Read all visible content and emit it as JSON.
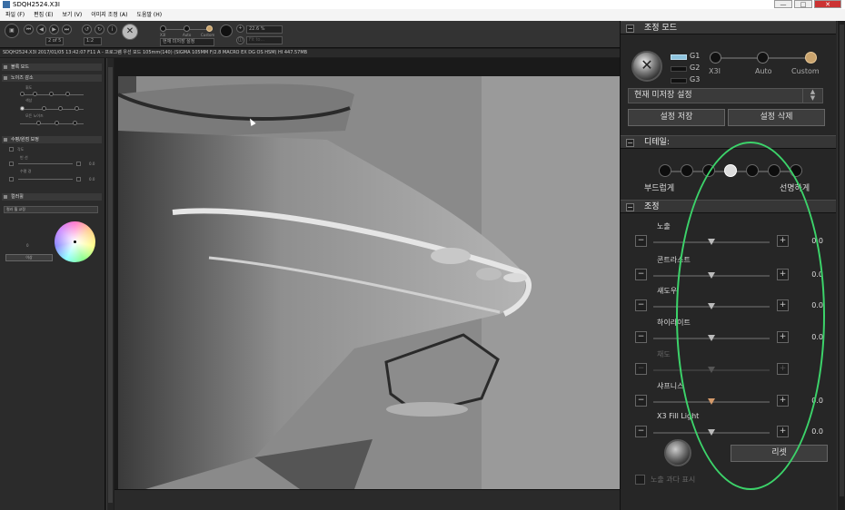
{
  "window": {
    "title": "SDQH2524.X3I",
    "buttons": [
      "—",
      "□",
      "✕"
    ]
  },
  "menu": [
    {
      "label": "파일 (F)"
    },
    {
      "label": "편집 (E)"
    },
    {
      "label": "보기 (V)"
    },
    {
      "label": "이미지 조정 (A)"
    },
    {
      "label": "도움말 (H)"
    }
  ],
  "toolbar": {
    "page": "2 of 5",
    "ratio": "1:2",
    "mode_labels": [
      "X3I",
      "Auto",
      "Custom"
    ],
    "preset": "현재 미저장 설정",
    "zoom": "22.6 %",
    "fit": "Fit to..."
  },
  "status_line": "SDQH2524.X3I 2017/01/05 13:42:07 F11 A - 프로그램 우선 모드 105mm(140) (SIGMA 105MM F/2.8 MACRO EX DG OS HSM) HI 447.57MB",
  "left_panel": {
    "sections": [
      {
        "label": "블록 모드"
      },
      {
        "label": "노이즈 감소"
      },
      {
        "label": "수평/원점 보정"
      },
      {
        "label": "컬러휠"
      }
    ],
    "noise_labels": [
      "휘도",
      "색상",
      "모든 노이즈"
    ],
    "horizontal_labels": [
      "각도",
      "빈 선",
      "수평 경"
    ],
    "color_values": [
      "0.0",
      "0.0"
    ],
    "color_mode": "컬러 휠 교정",
    "color_zero": "0",
    "color_button": "이상"
  },
  "right_panel": {
    "mode_section": "조정 모드",
    "g_labels": [
      "G1",
      "G2",
      "G3"
    ],
    "mode_labels": [
      "X3I",
      "Auto",
      "Custom"
    ],
    "preset_dropdown": "현재 미저장 설정",
    "save_button": "설정 저장",
    "delete_button": "설정 삭제",
    "detail_section": "디테일:",
    "detail_left": "부드럽게",
    "detail_right": "선명하게",
    "adjust_section": "조정",
    "sliders": [
      {
        "label": "노출",
        "value": "0.0"
      },
      {
        "label": "콘트라스트",
        "value": "0.0"
      },
      {
        "label": "섀도우",
        "value": "0.0"
      },
      {
        "label": "하이라이트",
        "value": "0.0"
      },
      {
        "label": "채도",
        "value": ""
      },
      {
        "label": "샤프니스",
        "value": "0.0"
      },
      {
        "label": "X3 Fill Light",
        "value": "0.0"
      }
    ],
    "reset_button": "리셋",
    "overexposure_label": "노출 과다 표시"
  },
  "colors": {
    "accent_custom": "#c9a36d",
    "g1_active": "#8cc3dd",
    "annotation": "#3cd36a"
  }
}
